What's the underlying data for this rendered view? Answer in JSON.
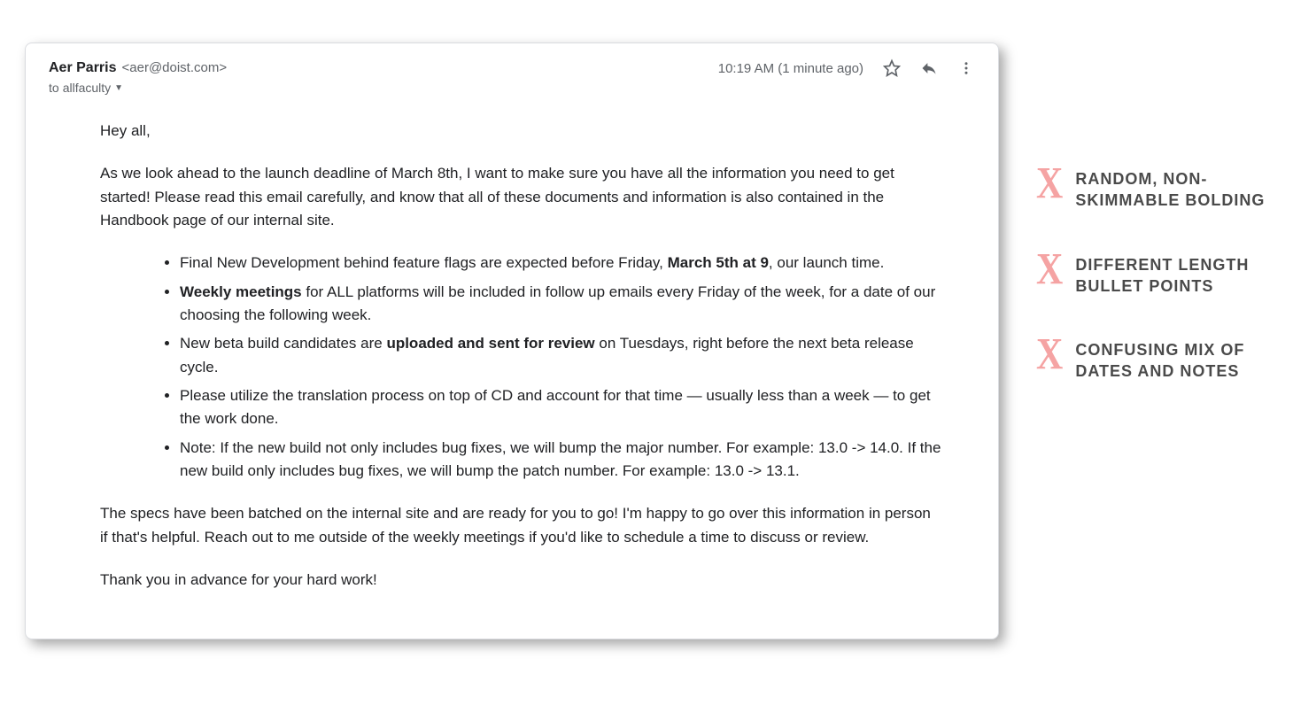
{
  "email": {
    "sender_name": "Aer Parris",
    "sender_email": "<aer@doist.com>",
    "timestamp": "10:19 AM (1 minute ago)",
    "to_prefix": "to",
    "to_recipient": "allfaculty",
    "greeting": "Hey all,",
    "para1": "As we look ahead to the launch deadline of March 8th, I want to make sure you have all the information you need to get started! Please read this email carefully, and know that all of these documents and information is also contained in the Handbook page of our internal site.",
    "bullets": {
      "b1_pre": "Final New Development behind feature flags are expected before Friday, ",
      "b1_bold": "March 5th at 9",
      "b1_post": ", our launch time.",
      "b2_bold": "Weekly meetings",
      "b2_post": " for ALL platforms will be included in follow up emails every Friday of the week, for a date of our choosing the following week.",
      "b3_pre": "New beta build candidates are ",
      "b3_bold": "uploaded and sent for review",
      "b3_post": " on Tuesdays, right before the next beta release cycle.",
      "b4": "Please utilize the translation process on top of CD and account for that time — usually less than a week — to get the work done.",
      "b5": "Note: If the new build not only includes bug fixes, we will bump the major number. For example: 13.0 -> 14.0. If the new build only includes bug fixes, we will bump the patch number. For example: 13.0 -> 13.1."
    },
    "para2": "The specs have been batched on the internal site and are ready for you to go! I'm happy to go over this information in person if that's helpful. Reach out to me outside of the weekly meetings if you'd like to schedule a time to discuss or review.",
    "closing": "Thank you in advance for your hard work!"
  },
  "annotations": {
    "a1": "Random, non-skimmable bolding",
    "a2": "Different length bullet points",
    "a3": "Confusing mix of dates and notes",
    "x": "X"
  }
}
